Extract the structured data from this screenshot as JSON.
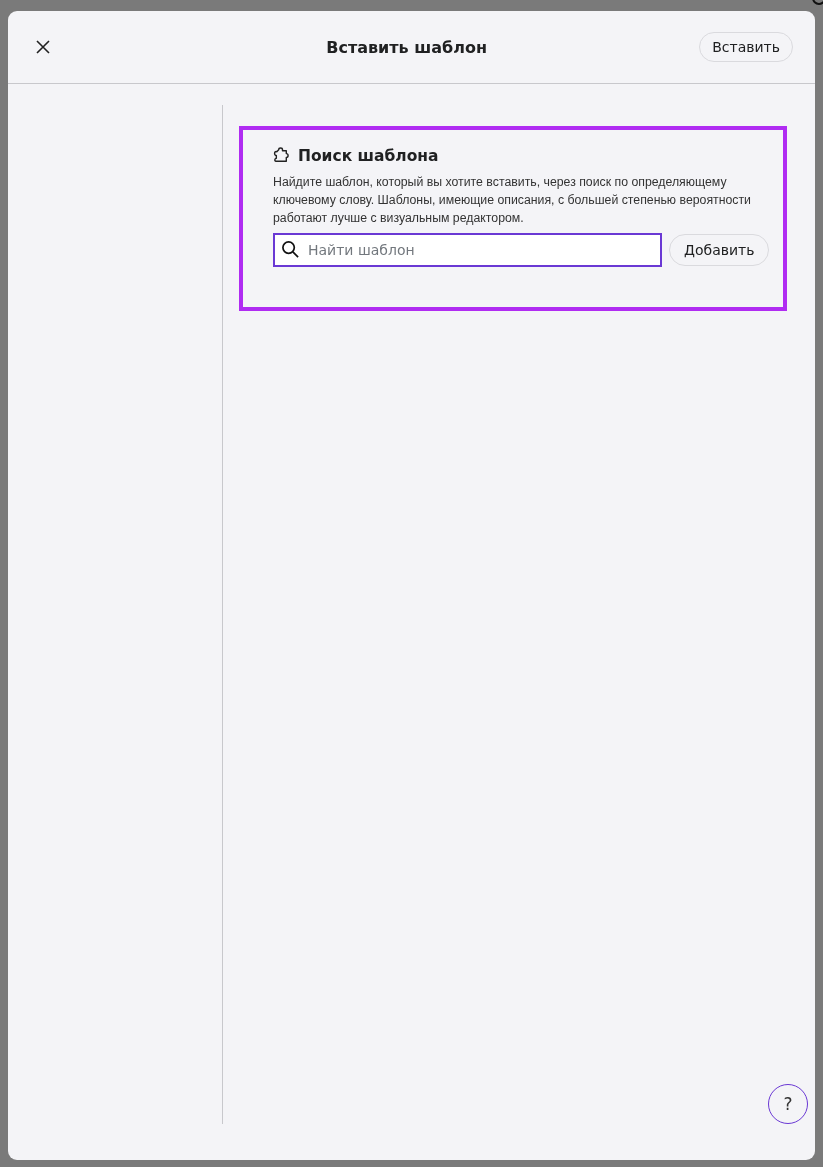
{
  "dialog": {
    "title": "Вставить шаблон",
    "insert_button": "Вставить"
  },
  "search_panel": {
    "title": "Поиск шаблона",
    "description": "Найдите шаблон, который вы хотите вставить, через поиск по определяющему ключевому слову. Шаблоны, имеющие описания, с большей степенью вероятности работают лучше с визуальным редактором.",
    "search": {
      "placeholder": "Найти шаблон"
    },
    "add_button": "Добавить"
  },
  "help_button": "?"
}
